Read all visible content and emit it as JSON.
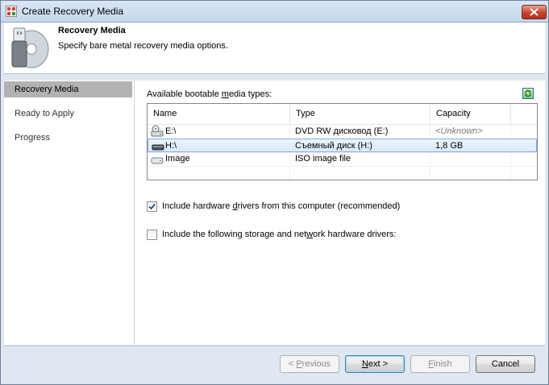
{
  "window": {
    "title": "Create Recovery Media"
  },
  "header": {
    "title": "Recovery Media",
    "subtitle": "Specify bare metal recovery media options."
  },
  "nav": {
    "items": [
      {
        "label": "Recovery Media",
        "active": true
      },
      {
        "label": "Ready to Apply",
        "active": false
      },
      {
        "label": "Progress",
        "active": false
      }
    ]
  },
  "media": {
    "label_prefix": "Available bootable ",
    "label_accel": "m",
    "label_suffix": "edia types:",
    "columns": [
      "Name",
      "Type",
      "Capacity"
    ],
    "rows": [
      {
        "icon": "dvd-drive-icon",
        "name": "E:\\",
        "type": "DVD RW дисковод (E:)",
        "capacity": "<Unknown>",
        "selected": false
      },
      {
        "icon": "removable-disk-icon",
        "name": "H:\\",
        "type": "Съемный диск (H:)",
        "capacity": "1,8 GB",
        "selected": true
      },
      {
        "icon": "iso-image-icon",
        "name": "Image",
        "type": "ISO image file",
        "capacity": "",
        "selected": false
      }
    ]
  },
  "options": {
    "include_drivers": {
      "checked": true,
      "label_prefix": "Include hardware ",
      "label_accel": "d",
      "label_suffix": "rivers from this computer (recommended)"
    },
    "include_storage": {
      "checked": false,
      "label_prefix": "Include the following storage and net",
      "label_accel": "w",
      "label_suffix": "ork hardware drivers:"
    }
  },
  "buttons": {
    "previous": {
      "prefix": "< ",
      "accel": "P",
      "suffix": "revious"
    },
    "next": {
      "prefix": "",
      "accel": "N",
      "suffix": "ext >"
    },
    "finish": {
      "prefix": "",
      "accel": "F",
      "suffix": "inish"
    },
    "cancel": {
      "label": "Cancel"
    }
  },
  "colors": {
    "selected_row": "#d9ebfb",
    "nav_active": "#b2b2b2",
    "close_button": "#c6452c"
  }
}
